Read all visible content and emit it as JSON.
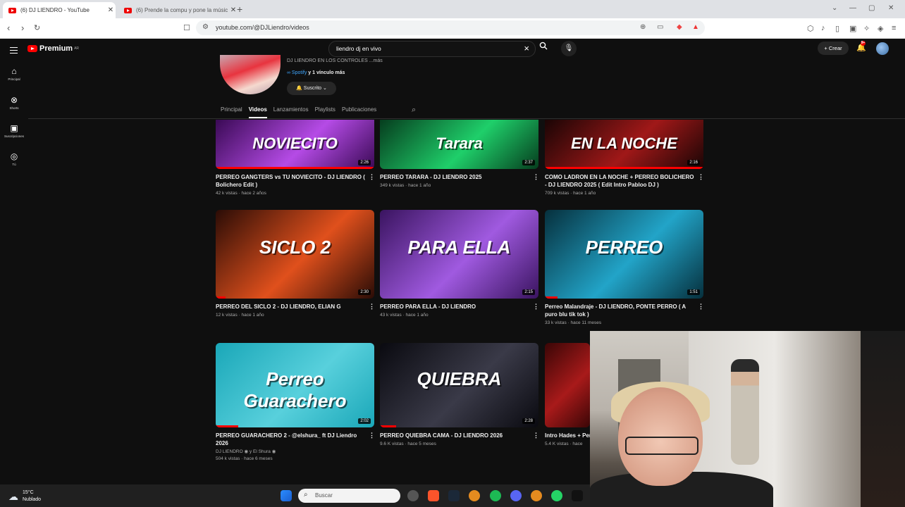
{
  "browser": {
    "tabs": [
      {
        "title": "(6) DJ LIENDRO - YouTube",
        "active": true
      },
      {
        "title": "(6) Prende la compu y pone la músic",
        "active": false
      }
    ],
    "url": "youtube.com/@DJLiendro/videos"
  },
  "youtube": {
    "logo_text": "Premium",
    "logo_sup": "AR",
    "search_query": "liendro dj en vivo",
    "create_label": "+ Crear",
    "notification_count": "9+",
    "rail": [
      {
        "icon": "home-icon",
        "label": "Principal"
      },
      {
        "icon": "shorts-icon",
        "label": "Shorts"
      },
      {
        "icon": "subscriptions-icon",
        "label": "Suscripciones"
      },
      {
        "icon": "you-icon",
        "label": "Tú"
      }
    ],
    "channel": {
      "description": "DJ LIENDRO EN LOS CONTROLES ...más",
      "link_prefix": "∞ Spotify",
      "link_rest": " y 1 vínculo más",
      "subscribe_label": "🔔 Suscrito ⌄"
    },
    "tabs": [
      "Principal",
      "Videos",
      "Lanzamientos",
      "Playlists",
      "Publicaciones"
    ],
    "active_tab": "Videos"
  },
  "videos": [
    {
      "thumb_text": "NOVIECITO",
      "duration": "2:26",
      "progress": 1.0,
      "title": "PERREO GANGTERS vs TU NOVIECITO - DJ LIENDRO ( Bolichero Edit )",
      "meta1": "42 k vistas · hace 2 años",
      "meta2": "",
      "colors": [
        "#3a0a55",
        "#b54be6"
      ]
    },
    {
      "thumb_text": "Tarara",
      "duration": "2:37",
      "progress": 0.0,
      "title": "PERREO TARARA - DJ LIENDRO 2025",
      "meta1": "349 k vistas · hace 1 año",
      "meta2": "",
      "colors": [
        "#063d1e",
        "#1fcf6a"
      ]
    },
    {
      "thumb_text": "EN LA NOCHE",
      "duration": "2:16",
      "progress": 1.0,
      "title": "COMO LADRON EN LA NOCHE + PERREO BOLICHERO - DJ LIENDRO 2025 ( Edit Intro Pabloo DJ )",
      "meta1": "709 k vistas · hace 1 año",
      "meta2": "",
      "colors": [
        "#1a0505",
        "#a01818"
      ]
    },
    {
      "thumb_text": "SICLO 2",
      "duration": "2:30",
      "progress": 0.06,
      "title": "PERREO DEL SICLO 2 - DJ LIENDRO, ELIAN G",
      "meta1": "12 k vistas · hace 1 año",
      "meta2": "",
      "colors": [
        "#2a0c06",
        "#e0501c"
      ]
    },
    {
      "thumb_text": "PARA ELLA",
      "duration": "2:15",
      "progress": 0.0,
      "title": "PERREO PARA ELLA - DJ LIENDRO",
      "meta1": "43 k vistas · hace 1 año",
      "meta2": "",
      "colors": [
        "#3a1460",
        "#a05ae0"
      ]
    },
    {
      "thumb_text": "PERREO",
      "duration": "1:51",
      "progress": 0.08,
      "title": "Perreo Malandraje - DJ LIENDRO, PONTE PERRO ( A puro blu tik tok )",
      "meta1": "33 k vistas · hace 11 meses",
      "meta2": "",
      "colors": [
        "#06303d",
        "#22a4c8"
      ]
    },
    {
      "thumb_text": "Perreo Guarachero",
      "duration": "2:02",
      "progress": 0.14,
      "title": "PERREO GUARACHERO 2 - @elshura_ ft DJ Liendro 2026",
      "meta1": "DJ LIENDRO ◉ y El Shura ◉",
      "meta2": "504 k vistas · hace 6 meses",
      "colors": [
        "#1aa7b8",
        "#58d0dc"
      ]
    },
    {
      "thumb_text": "QUIEBRA",
      "duration": "2:28",
      "progress": 0.1,
      "title": "PERREO QUIEBRA CAMA - DJ LIENDRO 2026",
      "meta1": "9.6 K vistas · hace 5 meses",
      "meta2": "",
      "colors": [
        "#0a0a10",
        "#3a3a48"
      ]
    },
    {
      "thumb_text": "",
      "duration": "",
      "progress": 0.0,
      "title": "Intro Hades + Per",
      "meta1": "5.4 K vistas · hace",
      "meta2": "",
      "colors": [
        "#3a0606",
        "#a81a1a"
      ]
    }
  ],
  "taskbar": {
    "temperature": "15°C",
    "weather": "Nublado",
    "search_placeholder": "Buscar"
  }
}
